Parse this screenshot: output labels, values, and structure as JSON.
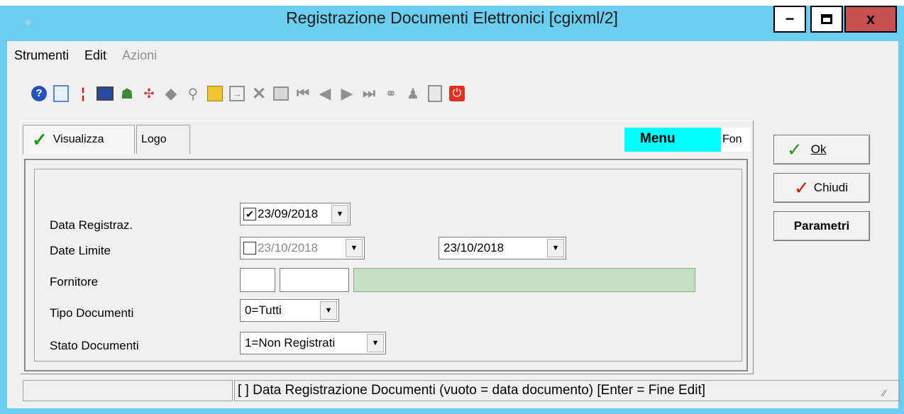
{
  "window": {
    "title": "Registrazione Documenti Elettronici [cgixml/2]",
    "controls": {
      "minimize": "−",
      "maximize": "□",
      "close": "x"
    }
  },
  "menu": {
    "items": [
      {
        "label": "Strumenti",
        "enabled": true
      },
      {
        "label": "Edit",
        "enabled": true
      },
      {
        "label": "Azioni",
        "enabled": false
      }
    ]
  },
  "toolbar": {
    "icons": [
      "help-icon",
      "preview-icon",
      "marker-icon",
      "monitor-icon",
      "users-icon",
      "network-icon",
      "diamond-icon",
      "key-icon",
      "folder-icon",
      "import-icon",
      "delete-icon",
      "grid-icon",
      "first-icon",
      "prev-icon",
      "next-icon",
      "last-icon",
      "link-icon",
      "stamp-icon",
      "document-icon",
      "power-icon"
    ]
  },
  "tabs": [
    {
      "label": "Visualizza",
      "active": true
    },
    {
      "label": "Logo",
      "active": false
    }
  ],
  "header_labels": {
    "menu": "Menu",
    "fon": "Fon"
  },
  "form": {
    "data_registraz": {
      "label": "Data Registraz.",
      "checked": true,
      "value": "23/09/2018"
    },
    "date_limite": {
      "label": "Date Limite",
      "checked": false,
      "from": "23/10/2018",
      "to": "23/10/2018"
    },
    "fornitore": {
      "label": "Fornitore",
      "code1": "",
      "code2": "",
      "name": ""
    },
    "tipo_documenti": {
      "label": "Tipo Documenti",
      "value": "0=Tutti"
    },
    "stato_documenti": {
      "label": "Stato Documenti",
      "value": "1=Non Registrati"
    }
  },
  "buttons": {
    "ok": "Ok",
    "chiudi": "Chiudi",
    "parametri": "Parametri"
  },
  "status": {
    "left": "",
    "message": "[ ] Data Registrazione Documenti (vuoto = data documento) [Enter = Fine Edit]"
  },
  "colors": {
    "frame": "#6ccdef",
    "menu_highlight": "#00ffff",
    "fornitore_name_bg": "#c4e0c4",
    "close_button": "#c75050"
  }
}
